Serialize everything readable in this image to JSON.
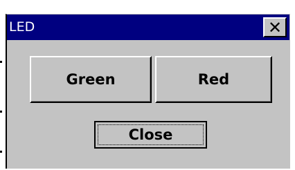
{
  "window": {
    "title": "LED",
    "close_glyph": "✕"
  },
  "buttons": {
    "green_label": "Green",
    "red_label": "Red",
    "close_label": "Close"
  },
  "colors": {
    "titlebar": "#000080",
    "face": "#c3c3c3",
    "title_text": "#ffffff"
  },
  "icons": {
    "titlebar_close": "close-icon"
  }
}
